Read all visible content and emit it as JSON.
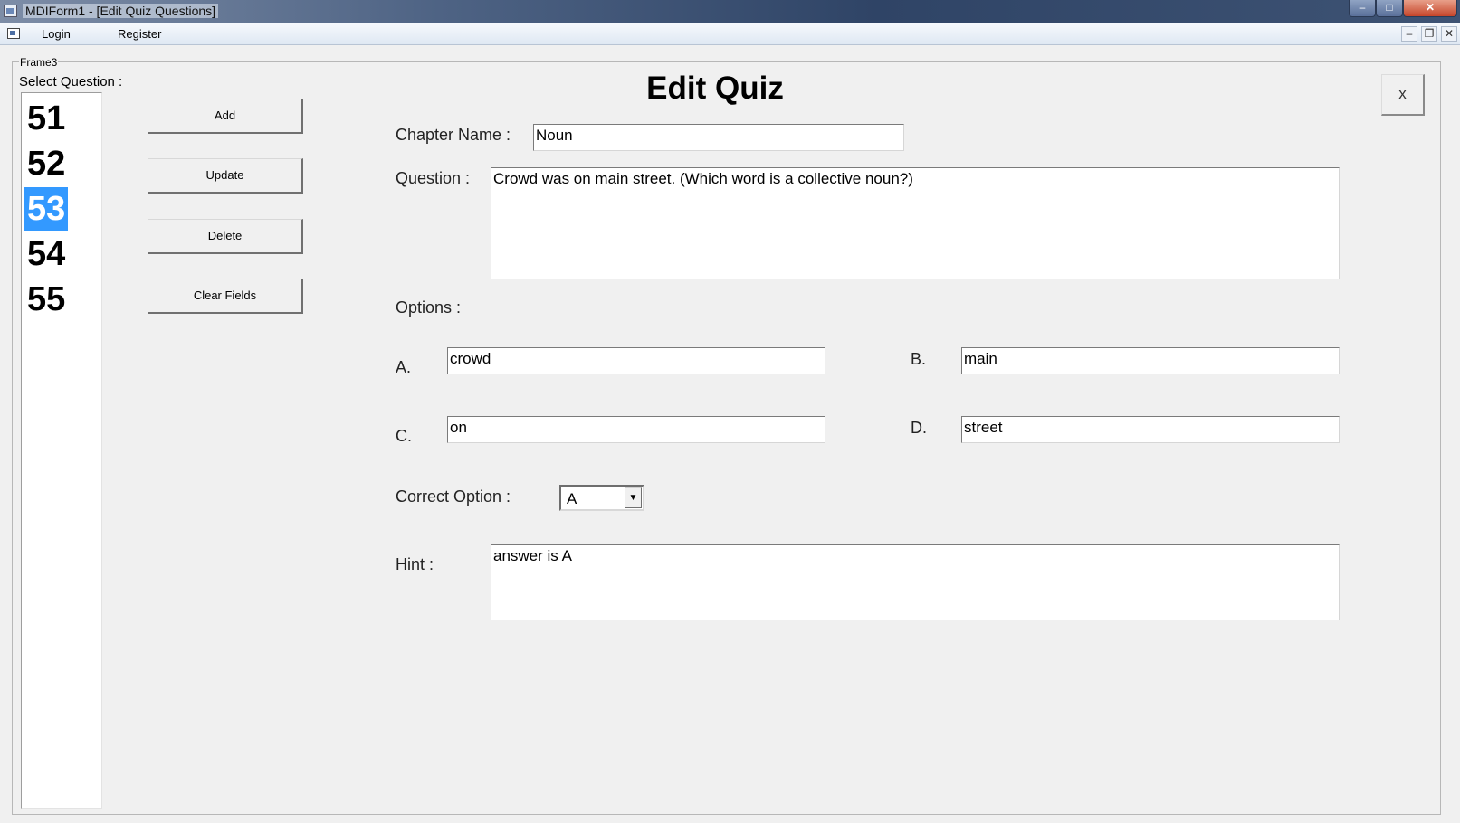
{
  "window": {
    "title": "MDIForm1 - [Edit Quiz Questions]",
    "controls": {
      "minimize": "–",
      "maximize": "□",
      "close": "✕"
    }
  },
  "menu": {
    "items": [
      "Login",
      "Register"
    ],
    "mdi_controls": {
      "minimize": "–",
      "restore": "❐",
      "close": "✕"
    }
  },
  "frame": {
    "caption": "Frame3",
    "select_question_label": "Select Question :",
    "questions": [
      "51",
      "52",
      "53",
      "54",
      "55"
    ],
    "selected_question": "53"
  },
  "actions": {
    "add": "Add",
    "update": "Update",
    "delete": "Delete",
    "clear": "Clear Fields"
  },
  "form": {
    "heading": "Edit Quiz",
    "close_glyph": "x",
    "chapter_label": "Chapter Name  :",
    "chapter_value": "Noun",
    "question_label": "Question :",
    "question_value": "Crowd was on main street. (Which word is a collective noun?)",
    "options_label": "Options :",
    "option_a_label": "A.",
    "option_a_value": "crowd",
    "option_b_label": "B.",
    "option_b_value": "main",
    "option_c_label": "C.",
    "option_c_value": "on",
    "option_d_label": "D.",
    "option_d_value": "street",
    "correct_label": "Correct Option :",
    "correct_value": "A",
    "hint_label": "Hint :",
    "hint_value": "answer is A"
  },
  "colors": {
    "selection": "#3399ff",
    "window_bg": "#f0f0f0"
  }
}
